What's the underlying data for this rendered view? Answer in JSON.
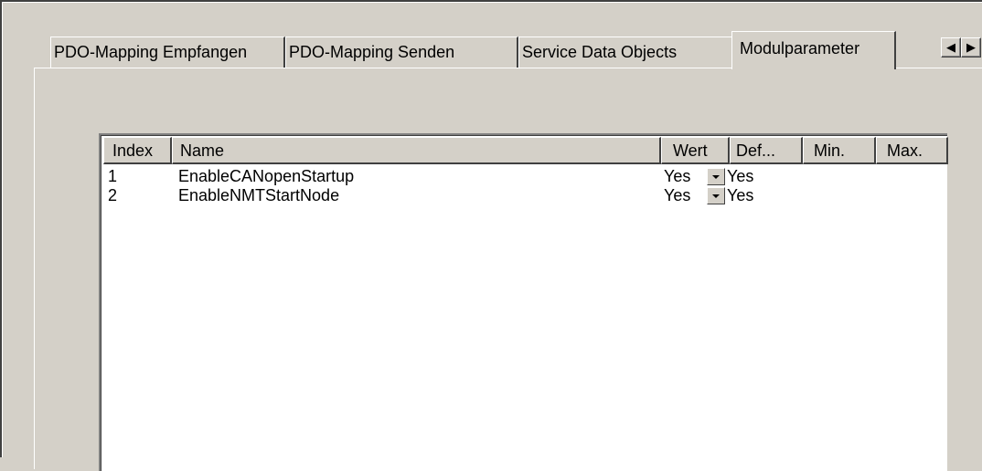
{
  "tabs": [
    {
      "label": "PDO-Mapping Empfangen",
      "active": false
    },
    {
      "label": "PDO-Mapping Senden",
      "active": false
    },
    {
      "label": "Service Data Objects",
      "active": false
    },
    {
      "label": "Modulparameter",
      "active": true
    }
  ],
  "tab_scroll": {
    "left_icon": "triangle-left-icon",
    "right_icon": "triangle-right-icon",
    "left_glyph": "◀",
    "right_glyph": "▶"
  },
  "table": {
    "columns": [
      "Index",
      "Name",
      "Wert",
      "Def...",
      "Min.",
      "Max."
    ],
    "rows": [
      {
        "index": "1",
        "name": "EnableCANopenStartup",
        "wert": "Yes",
        "def": "Yes",
        "min": "",
        "max": ""
      },
      {
        "index": "2",
        "name": "EnableNMTStartNode",
        "wert": "Yes",
        "def": "Yes",
        "min": "",
        "max": ""
      }
    ],
    "dropdown_icon": "chevron-down-icon"
  },
  "colors": {
    "face": "#d4d0c8",
    "shadow": "#808080",
    "dark_shadow": "#404040",
    "highlight": "#ffffff",
    "list_bg": "#ffffff"
  }
}
